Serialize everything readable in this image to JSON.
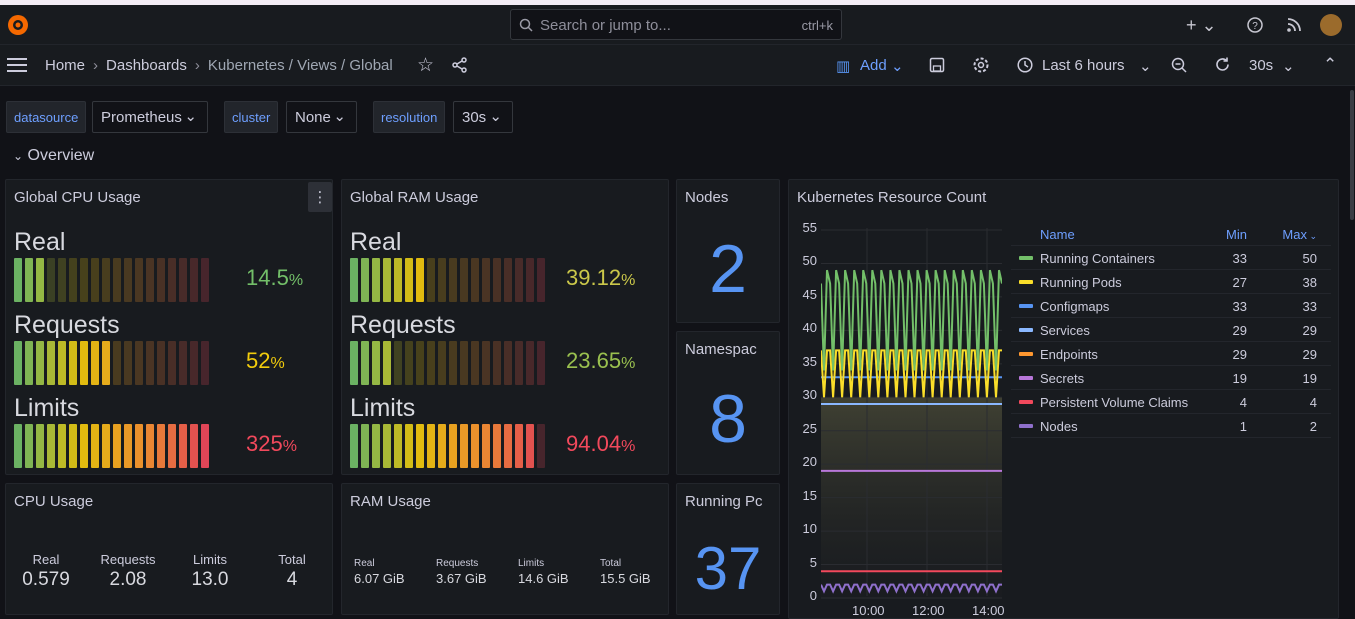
{
  "search": {
    "placeholder": "Search or jump to...",
    "shortcut": "ctrl+k"
  },
  "breadcrumb": {
    "home": "Home",
    "dashboards": "Dashboards",
    "current": "Kubernetes / Views / Global"
  },
  "toolbar": {
    "add": "Add",
    "time_range": "Last 6 hours",
    "refresh": "30s"
  },
  "variables": [
    {
      "label": "datasource",
      "value": "Prometheus"
    },
    {
      "label": "cluster",
      "value": "None"
    },
    {
      "label": "resolution",
      "value": "30s"
    }
  ],
  "section": "Overview",
  "cpu_panel": {
    "title": "Global CPU Usage",
    "rows": [
      {
        "label": "Real",
        "value": "14.5",
        "unit": "%",
        "fraction": 0.145,
        "color": "#73bf69"
      },
      {
        "label": "Requests",
        "value": "52",
        "unit": "%",
        "fraction": 0.52,
        "color": "#f2cc0c"
      },
      {
        "label": "Limits",
        "value": "325",
        "unit": "%",
        "fraction": 1.0,
        "color": "#f2495c"
      }
    ]
  },
  "ram_panel": {
    "title": "Global RAM Usage",
    "rows": [
      {
        "label": "Real",
        "value": "39.12",
        "unit": "%",
        "fraction": 0.39,
        "color": "#cbc84a"
      },
      {
        "label": "Requests",
        "value": "23.65",
        "unit": "%",
        "fraction": 0.24,
        "color": "#9ac14f"
      },
      {
        "label": "Limits",
        "value": "94.04",
        "unit": "%",
        "fraction": 0.94,
        "color": "#f2495c"
      }
    ]
  },
  "nodes": {
    "title": "Nodes",
    "value": "2"
  },
  "namespaces": {
    "title": "Namespac",
    "value": "8"
  },
  "running_pods": {
    "title": "Running Pc",
    "value": "37"
  },
  "cpu_usage": {
    "title": "CPU Usage",
    "stats": [
      {
        "label": "Real",
        "value": "0.579"
      },
      {
        "label": "Requests",
        "value": "2.08"
      },
      {
        "label": "Limits",
        "value": "13.0"
      },
      {
        "label": "Total",
        "value": "4"
      }
    ]
  },
  "ram_usage": {
    "title": "RAM Usage",
    "stats": [
      {
        "label": "Real",
        "value": "6.07 GiB"
      },
      {
        "label": "Requests",
        "value": "3.67 GiB"
      },
      {
        "label": "Limits",
        "value": "14.6 GiB"
      },
      {
        "label": "Total",
        "value": "15.5 GiB"
      }
    ]
  },
  "resource_panel": {
    "title": "Kubernetes Resource Count",
    "legend_headers": {
      "name": "Name",
      "min": "Min",
      "max": "Max"
    }
  },
  "chart_data": {
    "type": "line",
    "title": "Kubernetes Resource Count",
    "ylim": [
      0,
      55
    ],
    "yticks": [
      "55",
      "50",
      "45",
      "40",
      "35",
      "30",
      "25",
      "20",
      "15",
      "10",
      "5",
      "0"
    ],
    "xticks": [
      "10:00",
      "12:00",
      "14:00"
    ],
    "series": [
      {
        "name": "Running Containers",
        "min": "33",
        "max": "50",
        "base": 47,
        "color": "#73bf69"
      },
      {
        "name": "Running Pods",
        "min": "27",
        "max": "38",
        "base": 37,
        "color": "#fade2a"
      },
      {
        "name": "Configmaps",
        "min": "33",
        "max": "33",
        "base": 33,
        "color": "#5794f2"
      },
      {
        "name": "Services",
        "min": "29",
        "max": "29",
        "base": 29,
        "color": "#8ab8ff"
      },
      {
        "name": "Endpoints",
        "min": "29",
        "max": "29",
        "base": 29,
        "color": "#ff9830"
      },
      {
        "name": "Secrets",
        "min": "19",
        "max": "19",
        "base": 19,
        "color": "#b877d9"
      },
      {
        "name": "Persistent Volume Claims",
        "min": "4",
        "max": "4",
        "base": 4,
        "color": "#f2495c"
      },
      {
        "name": "Nodes",
        "min": "1",
        "max": "2",
        "base": 2,
        "color": "#8f70cc"
      }
    ]
  }
}
